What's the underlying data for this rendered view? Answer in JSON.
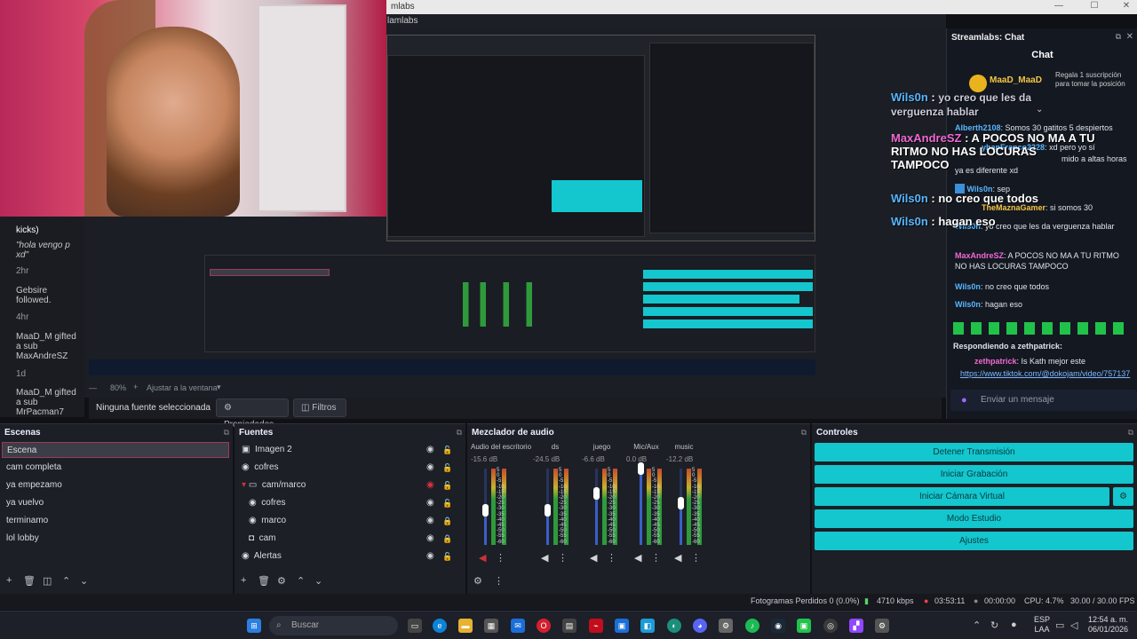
{
  "window": {
    "title_fragment": "mlabs",
    "menu_fragment": "lamlabs"
  },
  "zoom": {
    "level": "80%",
    "fit_label": "Ajustar a la ventana"
  },
  "sourcebar": {
    "selected": "Ninguna fuente seleccionada",
    "properties": "Propiedades",
    "filters": "Filtros"
  },
  "oldchat": {
    "items": [
      {
        "text": "kicks)"
      },
      {
        "text": "\"hola vengo p xd\""
      },
      {
        "text": "2hr"
      },
      {
        "text": "Gebsire followed."
      },
      {
        "text": "4hr"
      },
      {
        "text": "MaaD_M gifted a sub MaxAndreSZ"
      },
      {
        "text": "1d"
      },
      {
        "text": "MaaD_M gifted a sub MrPacman7"
      }
    ]
  },
  "chat": {
    "panel_title": "Streamlabs: Chat",
    "title": "Chat",
    "pinned_user": "MaaD_MaaD",
    "pinned_text": "Regala 1 suscripción para tomar la posición",
    "messages": [
      {
        "user": "Alberth2108",
        "text": "Somos 30 gatitos 5 despiertos"
      },
      {
        "user": "yhanFranco2228",
        "text": "xd pero yo sí"
      },
      {
        "user": "",
        "text": "mido a altas horas"
      },
      {
        "user": "",
        "text": "ya es diferente xd"
      },
      {
        "user": "Wils0n",
        "text": "sep"
      },
      {
        "user": "TheMaznaGamer",
        "text": "si somos 30"
      },
      {
        "user": "Wils0n",
        "text": "yo creo que les da verguenza hablar"
      },
      {
        "user": "MaxAndreSZ",
        "text": "A POCOS NO MA A TU RITMO NO HAS LOCURAS TAMPOCO"
      },
      {
        "user": "Wils0n",
        "text": "no creo que todos"
      },
      {
        "user": "Wils0n",
        "text": "hagan eso"
      }
    ],
    "reply_label": "Respondiendo a zethpatrick:",
    "reply_user": "zethpatrick",
    "reply_text": "Is Kath mejor este",
    "reply_link": "https://www.tiktok.com/@dokojam/video/757137",
    "input_placeholder": "Enviar un mensaje"
  },
  "overlay": {
    "m1_user": "Wils0n",
    "m1_text": "yo creo que les da verguenza hablar",
    "m2_user": "MaxAndreSZ",
    "m2_text": "A POCOS NO MA A TU RITMO NO HAS LOCURAS TAMPOCO",
    "m3_user": "Wils0n",
    "m3_text": "no creo que todos",
    "m4_user": "Wils0n",
    "m4_text": "hagan eso"
  },
  "scenes": {
    "title": "Escenas",
    "items": [
      "Escena",
      "cam completa",
      "ya empezamo",
      "ya vuelvo",
      "terminamo",
      "lol lobby"
    ]
  },
  "sources": {
    "title": "Fuentes",
    "items": [
      {
        "label": "Imagen 2",
        "icon": "image-icon"
      },
      {
        "label": "cofres",
        "icon": "browser-icon"
      },
      {
        "label": "cam/marco",
        "icon": "folder-icon"
      },
      {
        "label": "cofres",
        "icon": "browser-icon"
      },
      {
        "label": "marco",
        "icon": "browser-icon"
      },
      {
        "label": "cam",
        "icon": "camera-icon"
      },
      {
        "label": "Alertas",
        "icon": "browser-icon"
      }
    ]
  },
  "mixer": {
    "title": "Mezclador de audio",
    "channels": [
      {
        "name": "Audio del escritorio",
        "db": "-15.6 dB",
        "fader": 0.45
      },
      {
        "name": "ds",
        "db": "-24.5 dB",
        "fader": 0.45
      },
      {
        "name": "juego",
        "db": "-6.6 dB",
        "fader": 0.68
      },
      {
        "name": "Mic/Aux",
        "db": "0.0 dB",
        "fader": 1.0
      },
      {
        "name": "music",
        "db": "-12.2 dB",
        "fader": 0.55
      }
    ],
    "scale": [
      "5",
      "0",
      "-5",
      "-10",
      "-15",
      "-20",
      "-25",
      "-30",
      "-35",
      "-40",
      "-45",
      "-50",
      "-55",
      "-60"
    ]
  },
  "controls": {
    "title": "Controles",
    "stop_stream": "Detener Transmisión",
    "start_recording": "Iniciar Grabación",
    "start_virtual_cam": "Iniciar Cámara Virtual",
    "studio_mode": "Modo Estudio",
    "settings": "Ajustes"
  },
  "status": {
    "dropped": "Fotogramas Perdidos 0 (0.0%)",
    "bitrate": "4710 kbps",
    "stream_time": "03:53:11",
    "rec_time": "00:00:00",
    "cpu": "CPU: 4.7%",
    "fps": "30.00 / 30.00 FPS"
  },
  "taskbar": {
    "search": "Buscar",
    "lang1": "ESP",
    "lang2": "LAA",
    "time": "12:54 a. m.",
    "date": "06/01/2026"
  }
}
